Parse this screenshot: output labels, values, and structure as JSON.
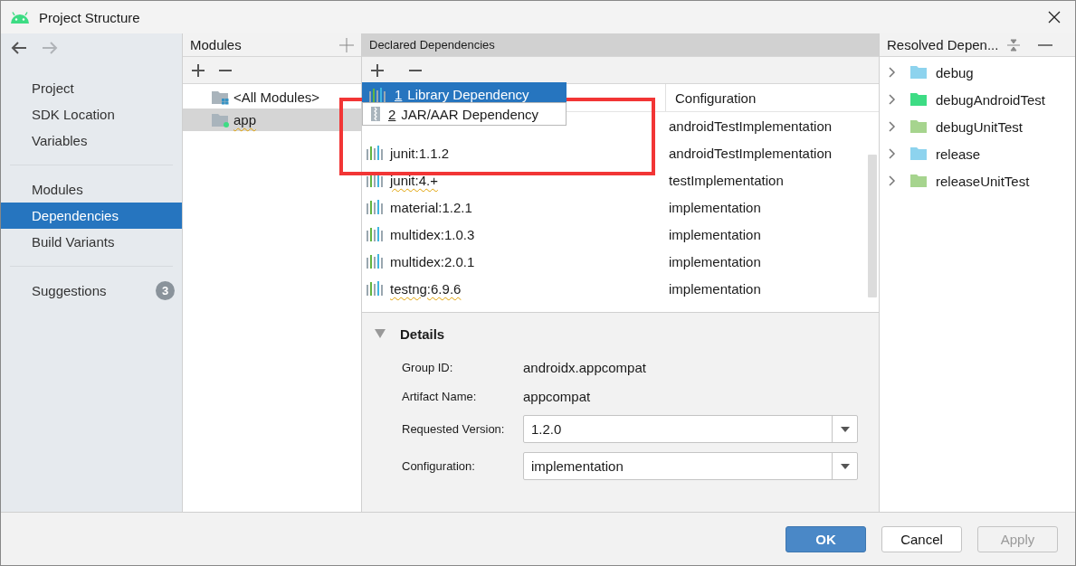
{
  "window": {
    "title": "Project Structure"
  },
  "nav": [
    {
      "kind": "back",
      "disabled": false
    },
    {
      "kind": "forward",
      "disabled": true
    }
  ],
  "sidebar": {
    "groups": [
      [
        {
          "label": "Project",
          "selected": false
        },
        {
          "label": "SDK Location",
          "selected": false
        },
        {
          "label": "Variables",
          "selected": false
        }
      ],
      [
        {
          "label": "Modules",
          "selected": false
        },
        {
          "label": "Dependencies",
          "selected": true
        },
        {
          "label": "Build Variants",
          "selected": false
        }
      ],
      [
        {
          "label": "Suggestions",
          "selected": false,
          "badge": "3"
        }
      ]
    ]
  },
  "modules": {
    "title": "Modules",
    "items": [
      {
        "label": "<All Modules>",
        "kind": "all",
        "selected": false,
        "warning": false
      },
      {
        "label": "app",
        "kind": "module",
        "selected": true,
        "warning": true
      }
    ]
  },
  "declared": {
    "title": "Declared Dependencies",
    "column_2": "Configuration",
    "rows": [
      {
        "configuration": "androidTestImplementation"
      },
      {
        "name": "junit:1.1.2",
        "configuration": "androidTestImplementation",
        "warning": false
      },
      {
        "name": "junit:4.+",
        "configuration": "testImplementation",
        "warning": true
      },
      {
        "name": "material:1.2.1",
        "configuration": "implementation",
        "warning": false
      },
      {
        "name": "multidex:1.0.3",
        "configuration": "implementation",
        "warning": false
      },
      {
        "name": "multidex:2.0.1",
        "configuration": "implementation",
        "warning": false
      },
      {
        "name": "testng:6.9.6",
        "configuration": "implementation",
        "warning": true
      }
    ],
    "popup": [
      {
        "number": "1",
        "label": "Library Dependency",
        "kind": "library",
        "selected": true
      },
      {
        "number": "2",
        "label": "JAR/AAR Dependency",
        "kind": "jar",
        "selected": false
      }
    ],
    "details": {
      "title": "Details",
      "expanded": true,
      "fields": [
        {
          "label": "Group ID:",
          "value": "androidx.appcompat",
          "kind": "text"
        },
        {
          "label": "Artifact Name:",
          "value": "appcompat",
          "kind": "text"
        },
        {
          "label": "Requested Version:",
          "value": "1.2.0",
          "kind": "combo"
        },
        {
          "label": "Configuration:",
          "value": "implementation",
          "kind": "combo"
        }
      ]
    }
  },
  "resolved": {
    "title": "Resolved Depen...",
    "items": [
      {
        "label": "debug",
        "color": "#8dd3ee"
      },
      {
        "label": "debugAndroidTest",
        "color": "#3ddc84"
      },
      {
        "label": "debugUnitTest",
        "color": "#a6d48e"
      },
      {
        "label": "release",
        "color": "#8dd3ee"
      },
      {
        "label": "releaseUnitTest",
        "color": "#a6d48e"
      }
    ]
  },
  "buttons": [
    {
      "label": "OK",
      "kind": "primary",
      "disabled": false
    },
    {
      "label": "Cancel",
      "kind": "default",
      "disabled": false
    },
    {
      "label": "Apply",
      "kind": "default",
      "disabled": true
    }
  ]
}
